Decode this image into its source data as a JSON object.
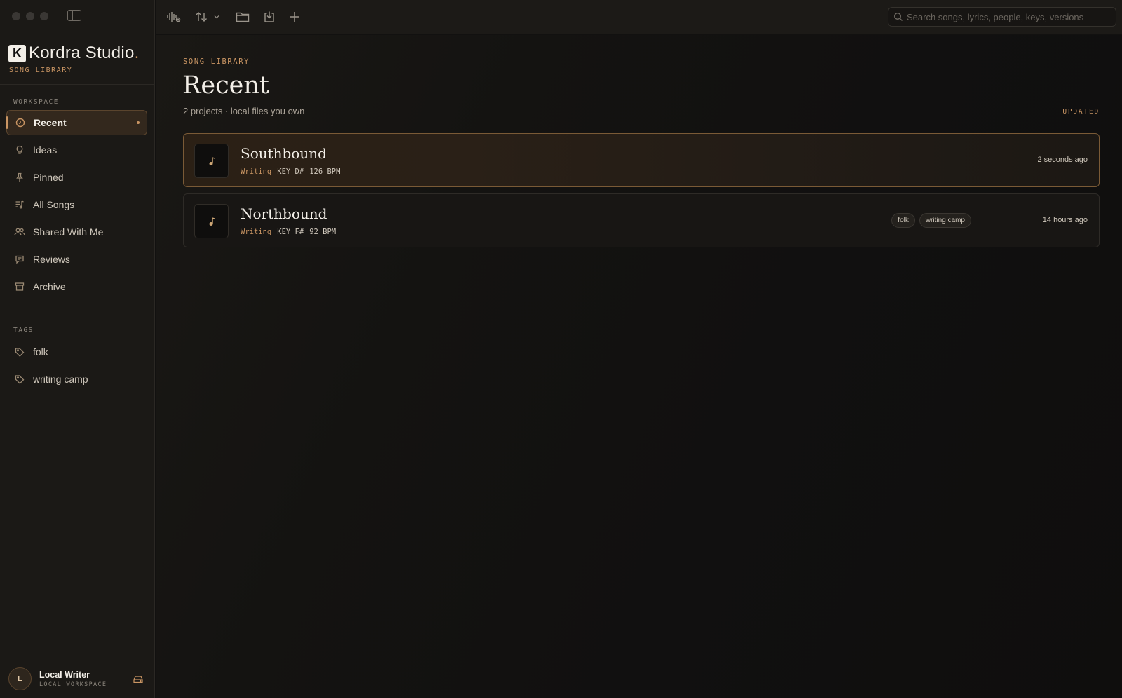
{
  "app": {
    "name": "Kordra Studio",
    "name_dot": ".",
    "logo_letter": "K",
    "subtitle": "SONG LIBRARY"
  },
  "sidebar": {
    "workspace_label": "WORKSPACE",
    "items": [
      {
        "label": "Recent",
        "icon": "clock-icon",
        "active": true
      },
      {
        "label": "Ideas",
        "icon": "lightbulb-icon"
      },
      {
        "label": "Pinned",
        "icon": "pin-icon"
      },
      {
        "label": "All Songs",
        "icon": "music-list-icon"
      },
      {
        "label": "Shared With Me",
        "icon": "users-icon"
      },
      {
        "label": "Reviews",
        "icon": "comment-icon"
      },
      {
        "label": "Archive",
        "icon": "archive-icon"
      }
    ],
    "tags_label": "TAGS",
    "tags": [
      {
        "label": "folk",
        "icon": "tag-icon"
      },
      {
        "label": "writing camp",
        "icon": "tag-icon"
      }
    ]
  },
  "user": {
    "initial": "L",
    "name": "Local Writer",
    "subtitle": "LOCAL WORKSPACE"
  },
  "search": {
    "placeholder": "Search songs, lyrics, people, keys, versions"
  },
  "main": {
    "eyebrow": "SONG LIBRARY",
    "title": "Recent",
    "subtitle": "2 projects · local files you own",
    "column_label": "UPDATED",
    "songs": [
      {
        "title": "Southbound",
        "status": "Writing",
        "key": "KEY D#",
        "bpm": "126 BPM",
        "updated": "2 seconds ago",
        "tags": [],
        "selected": true
      },
      {
        "title": "Northbound",
        "status": "Writing",
        "key": "KEY F#",
        "bpm": "92 BPM",
        "updated": "14 hours ago",
        "tags": [
          "folk",
          "writing camp"
        ],
        "selected": false
      }
    ]
  },
  "colors": {
    "accent": "#c99563",
    "background": "#121110",
    "sidebar": "#1b1916"
  }
}
